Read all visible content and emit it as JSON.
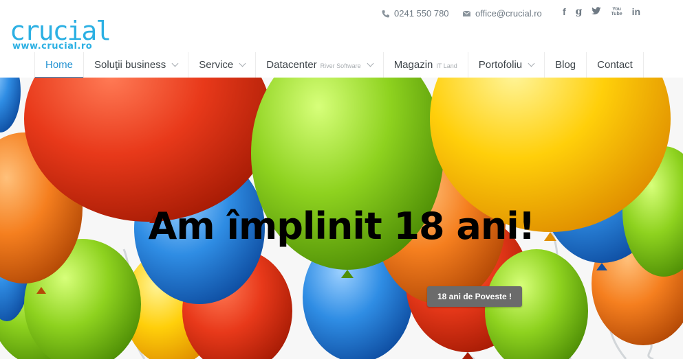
{
  "brand": {
    "name": "crucial",
    "url": "www.crucial.ro",
    "color": "#2cb0e3"
  },
  "contact": {
    "phone": "0241 550 780",
    "email": "office@crucial.ro"
  },
  "social": {
    "facebook": "f",
    "google": "g",
    "twitter": "twitter-icon",
    "youtube_top": "You",
    "youtube_bottom": "Tube",
    "linkedin": "in"
  },
  "nav": {
    "items": [
      {
        "label": "Home",
        "active": true
      },
      {
        "label": "Soluţii business",
        "dropdown": true
      },
      {
        "label": "Service",
        "dropdown": true
      },
      {
        "label": "Datacenter",
        "sub": "River Software",
        "dropdown": true
      },
      {
        "label": "Magazin",
        "sub": "IT Land"
      },
      {
        "label": "Portofoliu",
        "dropdown": true
      },
      {
        "label": "Blog"
      },
      {
        "label": "Contact"
      }
    ],
    "accent": "#2392d2"
  },
  "hero": {
    "title": "Am împlinit 18 ani!",
    "button": "18 ani de Poveste !",
    "balloon_colors": [
      "#e8391a",
      "#8ed21f",
      "#ffcf0a",
      "#2f8de4",
      "#f57f1f"
    ]
  }
}
